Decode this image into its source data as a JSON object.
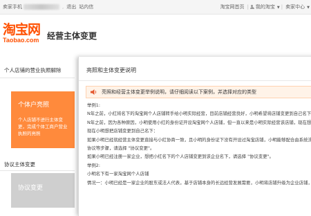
{
  "topbar": {
    "left_prefix": "卖家手机",
    "logout": "退出",
    "messages": "站内信",
    "right_home": "淘宝网首页",
    "right_mytaobao": "我的淘宝",
    "right_seller": "卖家中心"
  },
  "header": {
    "logo_cn": "淘宝网",
    "logo_en": "Taobao.com",
    "page_title": "经营主体变更"
  },
  "sidebar": {
    "section1_title": "个人店铺的营业执照解除",
    "card1_title": "个体户亮照",
    "card1_desc": "个人店铺不进行主体变更，完成个体工商户营业执照的亮照",
    "section2_title": "协议主体变更",
    "card2_title": "协议变更"
  },
  "modal": {
    "title": "亮照和主体变更说明",
    "notice": "亮照和经营主体变更举例说明，请仔细阅读以下案例，并选择对应的类型",
    "lines": [
      "举例1:",
      "N年之前，小红将名下的淘宝网个人店铺转手给小明实际经营，目前店铺经营良好，小明希望将店铺变更到自己名下。",
      "N年之前，因为各种原因，小明使用小红的身份证开设淘宝网个人店铺，但一直以来是小明实际经营该店铺，现在想把店铺",
      "现在小明想把店铺变更到自己名下：",
      "如果小明已经就经营主体变更直接与小红协商一致，且小明的身份证下没有开设过淘宝店铺，小明能够配合由系统流程，",
      "协议等步骤，请选择 \"协议变更\"。",
      "如果小明已经注册一家企业，想把小红名下的个人店铺变更到该企业名下，请选择 \"协议变更\"。",
      "举例2:",
      "小明名下有一家淘宝网个人店铺",
      "情况一：小明已经是一家企业的股东或法人代表，基于店铺本身的长远经营发展需要，小明将店铺升级为企业店铺，小明"
    ]
  }
}
